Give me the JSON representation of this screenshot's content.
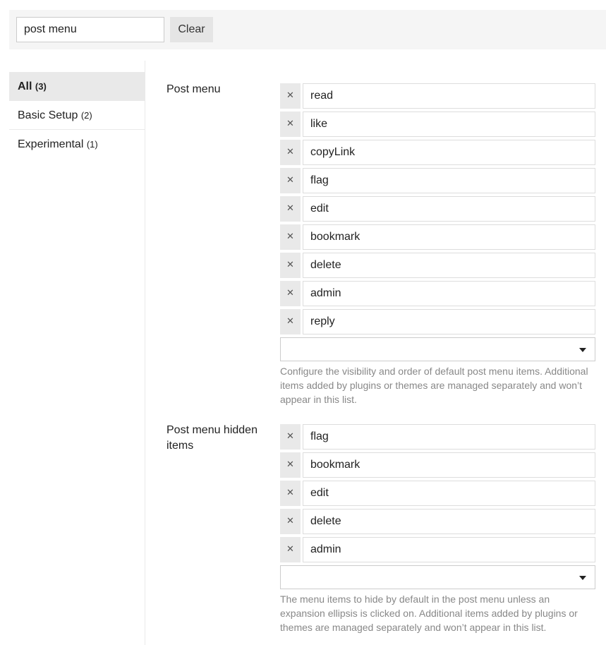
{
  "search": {
    "value": "post menu",
    "clear_label": "Clear"
  },
  "sidebar": {
    "items": [
      {
        "label": "All",
        "count": "(3)"
      },
      {
        "label": "Basic Setup",
        "count": "(2)"
      },
      {
        "label": "Experimental",
        "count": "(1)"
      }
    ]
  },
  "settings": {
    "post_menu": {
      "label": "Post menu",
      "items": [
        "read",
        "like",
        "copyLink",
        "flag",
        "edit",
        "bookmark",
        "delete",
        "admin",
        "reply"
      ],
      "description": "Configure the visibility and order of default post menu items. Additional items added by plugins or themes are managed separately and won’t appear in this list."
    },
    "post_menu_hidden": {
      "label": "Post menu hidden items",
      "items": [
        "flag",
        "bookmark",
        "edit",
        "delete",
        "admin"
      ],
      "description": "The menu items to hide by default in the post menu unless an expansion ellipsis is clicked on. Additional items added by plugins or themes are managed separately and won’t appear in this list."
    }
  },
  "icons": {
    "remove": "close-icon",
    "dropdown": "caret-down-icon"
  },
  "colors": {
    "sidebar_active_bg": "#e9e9e9",
    "description_text": "#888888"
  }
}
